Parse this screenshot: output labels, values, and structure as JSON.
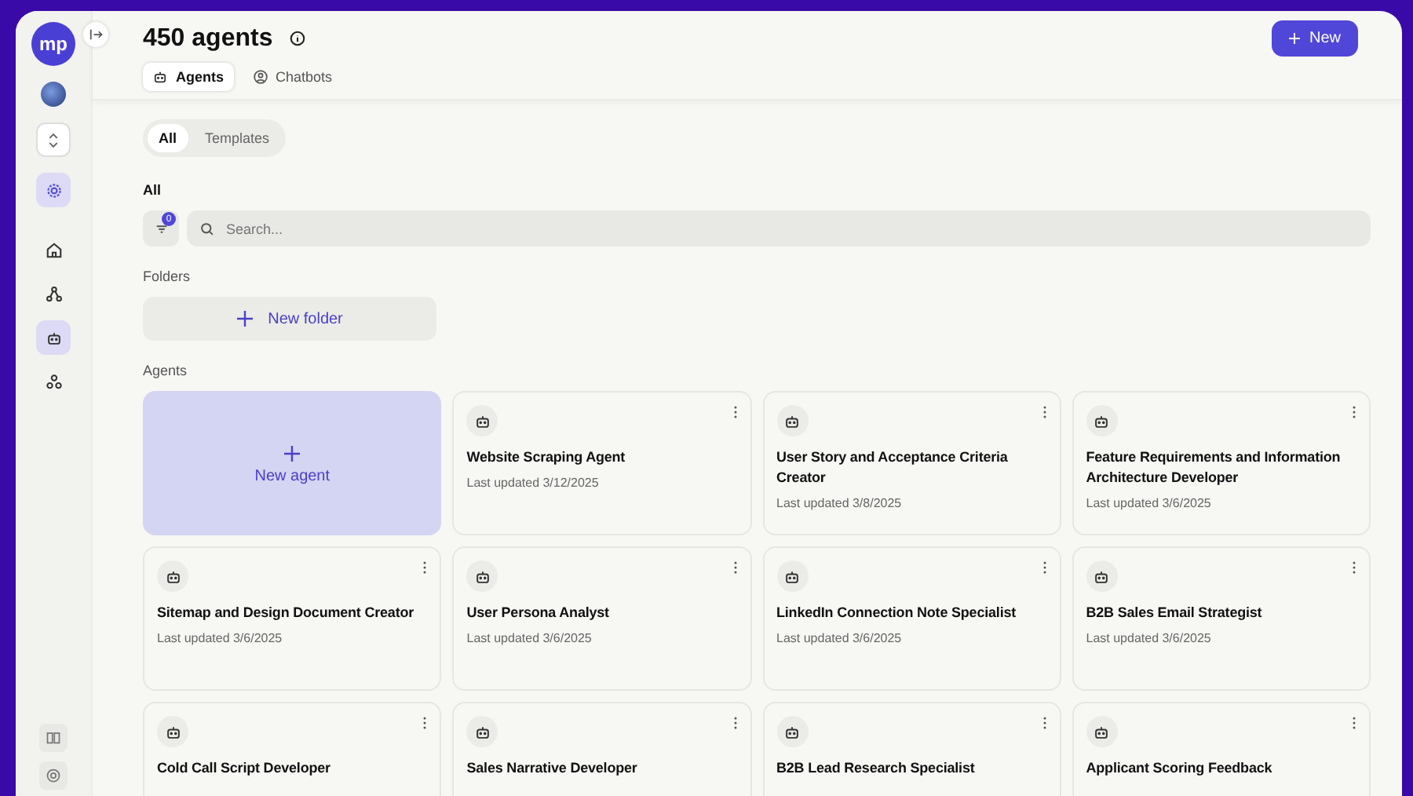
{
  "logo": "mp",
  "sidebar": {
    "items": [
      {
        "kind": "home",
        "selected": false
      },
      {
        "kind": "nodes",
        "selected": false
      },
      {
        "kind": "robot",
        "selected": true
      },
      {
        "kind": "group",
        "selected": false
      }
    ]
  },
  "header": {
    "title": "450 agents",
    "new_button": "New",
    "tabs": [
      {
        "label": "Agents",
        "kind": "robot",
        "selected": true
      },
      {
        "label": "Chatbots",
        "kind": "person",
        "selected": false
      }
    ]
  },
  "filters": [
    {
      "label": "All",
      "selected": true
    },
    {
      "label": "Templates",
      "selected": false
    }
  ],
  "section_label": "All",
  "filter_badge": "0",
  "search": {
    "placeholder": "Search..."
  },
  "folders": {
    "label": "Folders",
    "new_folder": "New folder"
  },
  "agents": {
    "label": "Agents",
    "new_agent": "New agent",
    "items": [
      {
        "name": "Website Scraping Agent",
        "updated": "Last updated 3/12/2025"
      },
      {
        "name": "User Story and Acceptance Criteria Creator",
        "updated": "Last updated 3/8/2025"
      },
      {
        "name": "Feature Requirements and Information Architecture Developer",
        "updated": "Last updated 3/6/2025"
      },
      {
        "name": "Sitemap and Design Document Creator",
        "updated": "Last updated 3/6/2025"
      },
      {
        "name": "User Persona Analyst",
        "updated": "Last updated 3/6/2025"
      },
      {
        "name": "LinkedIn Connection Note Specialist",
        "updated": "Last updated 3/6/2025"
      },
      {
        "name": "B2B Sales Email Strategist",
        "updated": "Last updated 3/6/2025"
      },
      {
        "name": "Cold Call Script Developer"
      },
      {
        "name": "Sales Narrative Developer"
      },
      {
        "name": "B2B Lead Research Specialist"
      },
      {
        "name": "Applicant Scoring Feedback"
      }
    ]
  }
}
